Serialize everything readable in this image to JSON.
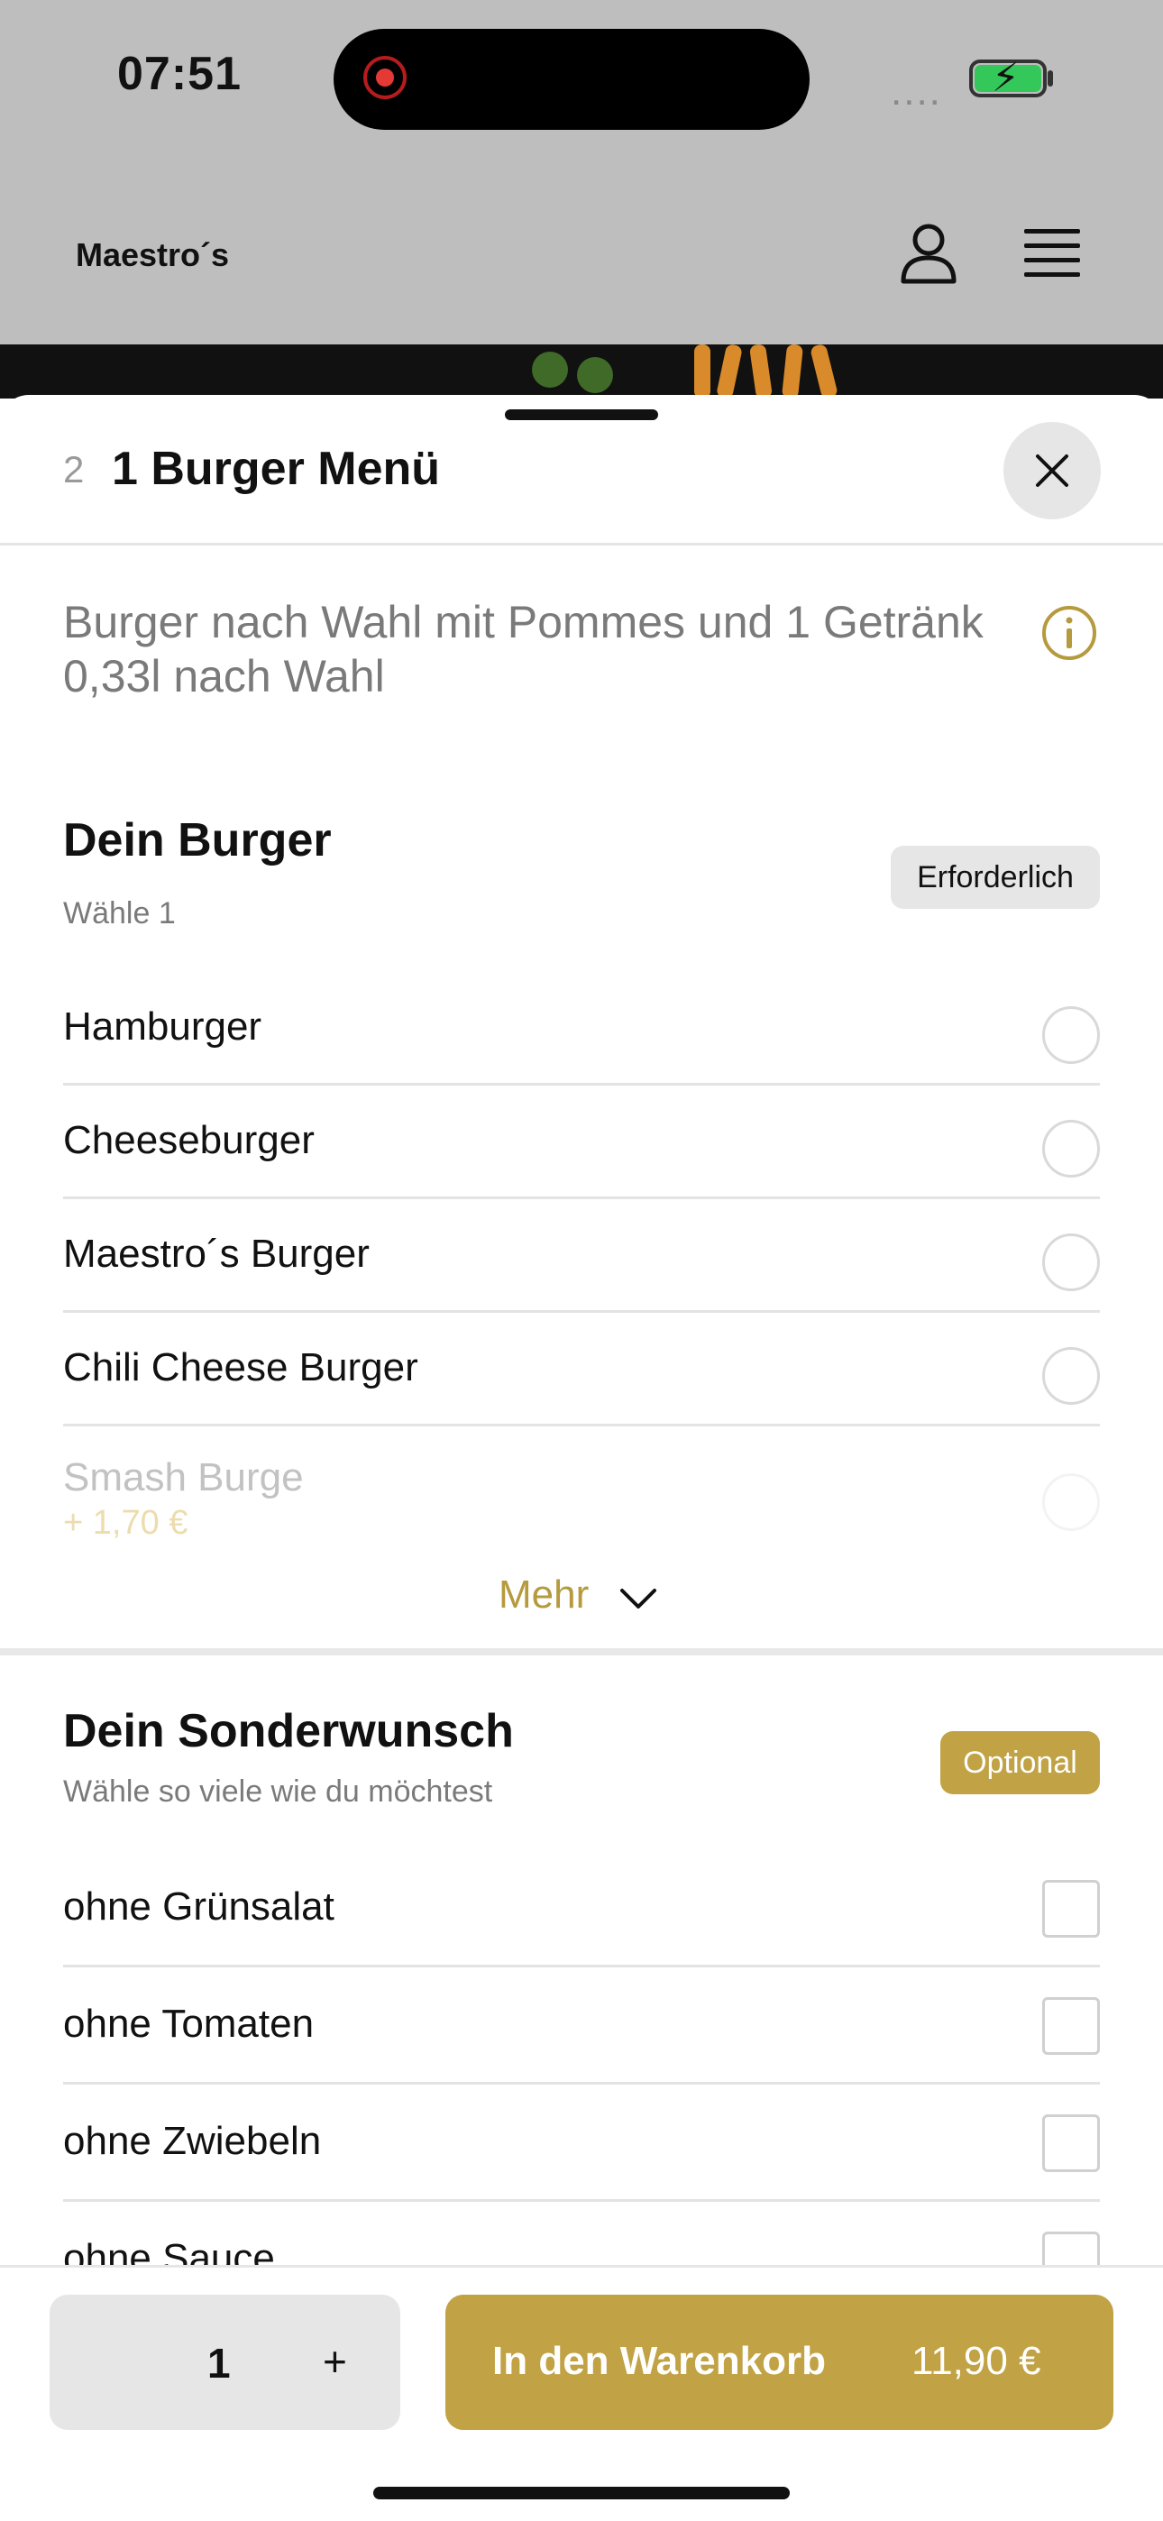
{
  "status_bar": {
    "time": "07:51",
    "signal_text": "....",
    "battery_icon": "battery-charging-icon",
    "recording_icon": "screen-recording-icon"
  },
  "nav": {
    "brand": "Maestro´s",
    "account_icon": "user-icon",
    "menu_icon": "hamburger-menu-icon"
  },
  "sheet": {
    "step": "2",
    "title": "1 Burger Menü",
    "close_icon": "close-icon",
    "description": "Burger nach Wahl mit Pommes und 1 Getränk 0,33l nach Wahl",
    "info_icon": "info-icon"
  },
  "burger_section": {
    "title": "Dein Burger",
    "subtitle": "Wähle 1",
    "badge": "Erforderlich",
    "options": [
      {
        "label": "Hamburger"
      },
      {
        "label": "Cheeseburger"
      },
      {
        "label": "Maestro´s Burger"
      },
      {
        "label": "Chili Cheese Burger"
      }
    ],
    "faded_option": {
      "label": "Smash Burge",
      "price": "+ 1,70 €"
    },
    "more_label": "Mehr"
  },
  "extras_section": {
    "title": "Dein Sonderwunsch",
    "subtitle": "Wähle so viele wie du möchtest",
    "badge": "Optional",
    "options": [
      {
        "label": "ohne Grünsalat"
      },
      {
        "label": "ohne Tomaten"
      },
      {
        "label": "ohne Zwiebeln"
      },
      {
        "label": "ohne Sauce"
      }
    ]
  },
  "footer": {
    "quantity": "1",
    "plus": "+",
    "cart_label": "In den Warenkorb",
    "cart_price": "11,90 €"
  },
  "colors": {
    "accent": "#c1a244",
    "overlay": "#bebebe",
    "muted_text": "#7a7a7a"
  }
}
